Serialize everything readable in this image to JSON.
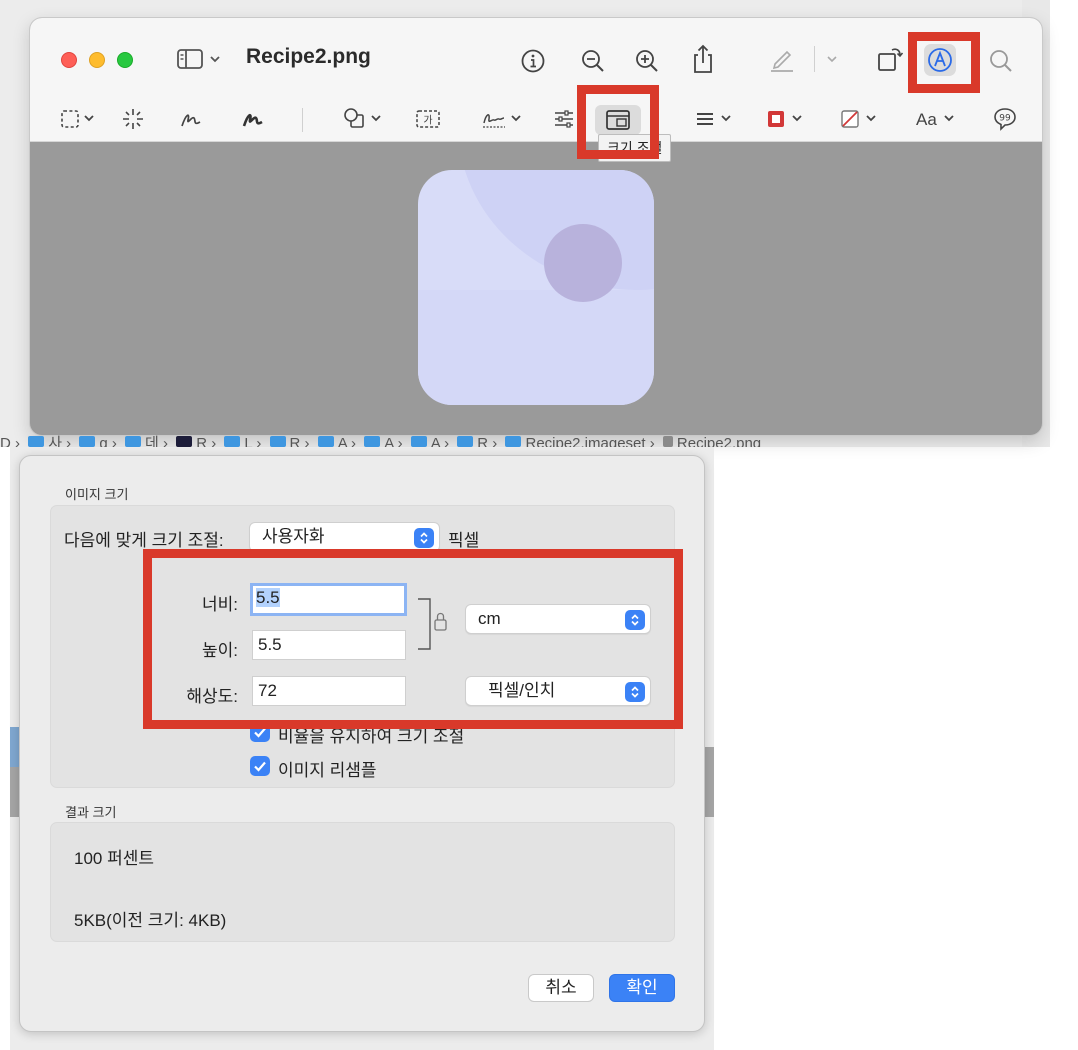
{
  "window": {
    "title": "Recipe2.png"
  },
  "toolbar": {
    "tooltip": "크기 조절"
  },
  "breadcrumb": [
    "D",
    "사",
    "g",
    "데",
    "R",
    "L",
    "R",
    "A",
    "A",
    "A",
    "R",
    "Recipe2.imageset",
    "Recipe2.png"
  ],
  "dialog": {
    "image_size_label": "이미지 크기",
    "fit_label": "다음에 맞게 크기 조절:",
    "fit_value": "사용자화",
    "fit_unit": "픽셀",
    "width_label": "너비:",
    "width_value": "5.5",
    "height_label": "높이:",
    "height_value": "5.5",
    "resolution_label": "해상도:",
    "resolution_value": "72",
    "size_unit_value": "cm",
    "resolution_unit_value": "픽셀/인치",
    "scale_proportionally_label": "비율을 유지하여 크기 조절",
    "scale_proportionally_checked": true,
    "resample_label": "이미지 리샘플",
    "resample_checked": true,
    "result_size_label": "결과 크기",
    "result_percent": "100 퍼센트",
    "result_bytes": "5KB(이전 크기: 4KB)",
    "cancel_label": "취소",
    "ok_label": "확인"
  },
  "colors": {
    "highlight": "#d9392a",
    "accent": "#3b82f6"
  }
}
